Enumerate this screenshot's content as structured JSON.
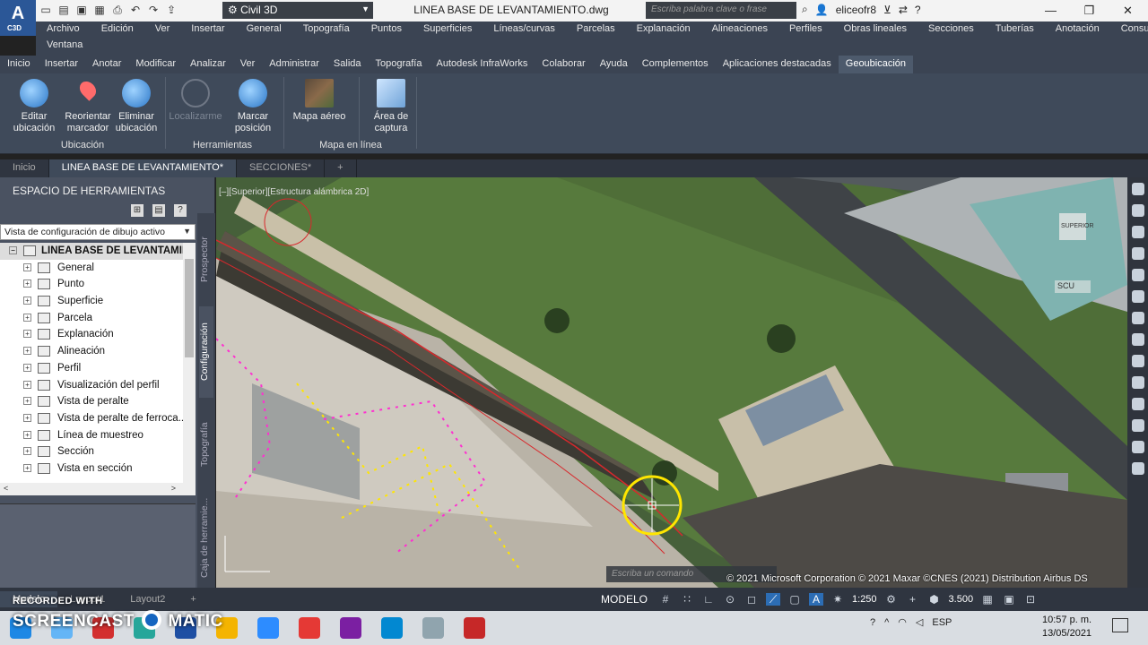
{
  "app": {
    "logo_letter": "A",
    "logo_sub": "C3D",
    "workspace": "Civil 3D",
    "document_title": "LINEA BASE DE LEVANTAMIENTO.dwg",
    "search_placeholder": "Escriba palabra clave o frase",
    "user": "eliceofr8"
  },
  "menubar": {
    "row1": [
      "Archivo",
      "Edición",
      "Ver",
      "Insertar",
      "General",
      "Topografía",
      "Puntos",
      "Superficies",
      "Líneas/curvas",
      "Parcelas",
      "Explanación",
      "Alineaciones",
      "Perfiles",
      "Obras lineales",
      "Secciones",
      "Tuberías",
      "Anotación",
      "Consulta"
    ],
    "row2": [
      "Ventana"
    ]
  },
  "ribbon_tabs": [
    "Inicio",
    "Insertar",
    "Anotar",
    "Modificar",
    "Analizar",
    "Ver",
    "Administrar",
    "Salida",
    "Topografía",
    "Autodesk InfraWorks",
    "Colaborar",
    "Ayuda",
    "Complementos",
    "Aplicaciones destacadas",
    "Geoubicación"
  ],
  "ribbon_active_tab": "Geoubicación",
  "ribbon": {
    "buttons": [
      {
        "label1": "Editar",
        "label2": "ubicación"
      },
      {
        "label1": "Reorientar",
        "label2": "marcador"
      },
      {
        "label1": "Eliminar",
        "label2": "ubicación"
      },
      {
        "label1": "Localizarme",
        "label2": ""
      },
      {
        "label1": "Marcar",
        "label2": "posición"
      },
      {
        "label1": "Mapa aéreo",
        "label2": ""
      },
      {
        "label1": "Área de",
        "label2": "captura"
      }
    ],
    "panels": [
      "Ubicación",
      "Herramientas",
      "Mapa en línea"
    ]
  },
  "doc_tabs": [
    "Inicio",
    "LINEA BASE DE LEVANTAMIENTO*",
    "SECCIONES*",
    "+"
  ],
  "toolspace": {
    "title": "ESPACIO DE HERRAMIENTAS",
    "view_select": "Vista de configuración de dibujo activo",
    "root": "LINEA BASE DE LEVANTAMIE...",
    "items": [
      "General",
      "Punto",
      "Superficie",
      "Parcela",
      "Explanación",
      "Alineación",
      "Perfil",
      "Visualización del perfil",
      "Vista de peralte",
      "Vista de peralte de ferroca...",
      "Línea de muestreo",
      "Sección",
      "Vista en sección"
    ],
    "side_tabs": [
      "Prospector",
      "Configuración",
      "Topografía",
      "Caja de herramie..."
    ]
  },
  "viewport": {
    "label": "[–][Superior][Estructura alámbrica 2D]",
    "viewcube_top": "SUPERIOR",
    "viewcube_compass": "SCU",
    "command_placeholder": "Escriba un comando",
    "copyright": "© 2021 Microsoft Corporation © 2021 Maxar ©CNES (2021) Distribution Airbus DS"
  },
  "layout_tabs": [
    "Modelo",
    "Layout1",
    "Layout2",
    "+"
  ],
  "status": {
    "mode": "MODELO",
    "scale": "1:250",
    "value": "3.500"
  },
  "taskbar": {
    "lang": "ESP",
    "time": "10:57 p. m.",
    "date": "13/05/2021"
  },
  "watermark": {
    "line1": "RECORDED WITH",
    "line2": "SCREENCAST",
    "line3": "MATIC"
  },
  "colors": {
    "ribbon_bg": "#3f4a5a",
    "menubar_bg": "#3b4453",
    "accent_blue": "#2c6db5",
    "satellite_green": "#3f5a2e",
    "red_polyline": "#d8282c",
    "magenta_markers": "#ff2fd0",
    "yellow_markers": "#ffe600"
  }
}
